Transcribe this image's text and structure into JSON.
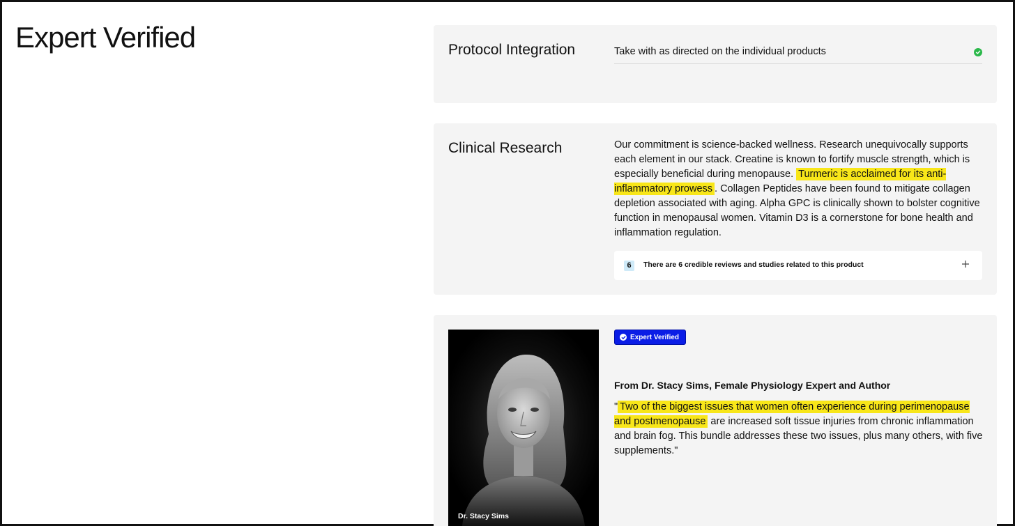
{
  "page": {
    "title": "Expert Verified"
  },
  "protocol": {
    "label": "Protocol Integration",
    "text": "Take with as directed on the individual products",
    "status_icon": "check-circle-icon",
    "status_color": "#2bb84a"
  },
  "clinical": {
    "label": "Clinical Research",
    "body_before": "Our commitment is science-backed wellness. Research unequivocally supports each element in our stack. Creatine is known to fortify muscle strength, which is especially beneficial during menopause. ",
    "body_highlight": "Turmeric is acclaimed for its anti-inflammatory prowess",
    "body_after": ". Collagen Peptides have been found to mitigate collagen depletion associated with aging. Alpha GPC is clinically shown to bolster cognitive function in menopausal women. Vitamin D3 is a cornerstone for bone health and inflammation regulation.",
    "highlight_color": "#f8e619",
    "reviews": {
      "count": "6",
      "text": "There are 6 credible reviews and studies related to this product",
      "toggle_icon": "plus-icon"
    }
  },
  "expert": {
    "badge_label": "Expert Verified",
    "badge_icon": "verified-check-icon",
    "badge_color": "#0a1de6",
    "name_line": "From Dr. Stacy Sims, Female Physiology Expert and Author",
    "quote_open": "\"",
    "quote_highlight": "Two of the biggest issues that women often experience during perimenopause and postmenopause",
    "quote_rest": " are increased soft tissue injuries from chronic inflammation and brain fog. This bundle addresses these two issues, plus many others, with five supplements.\"",
    "photo_caption": "Dr. Stacy Sims"
  }
}
